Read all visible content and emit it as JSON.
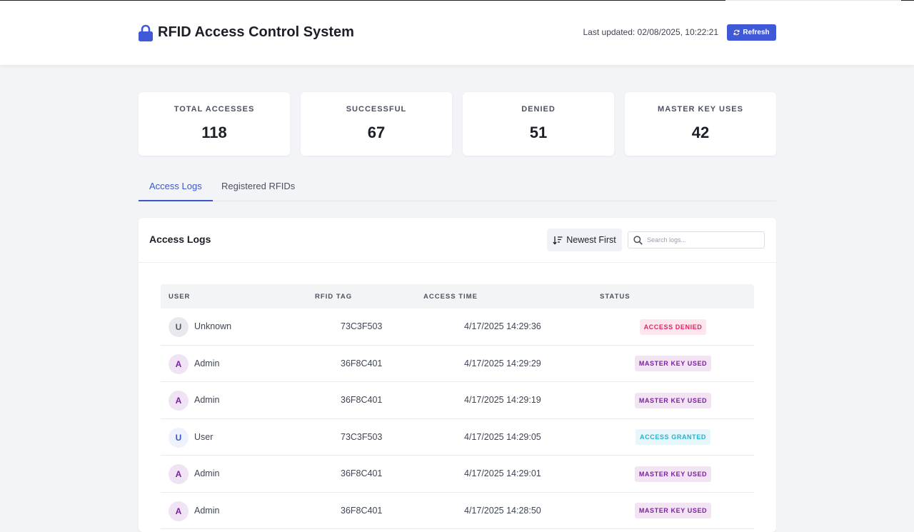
{
  "header": {
    "title": "RFID Access Control System",
    "last_updated": "Last updated: 02/08/2025, 10:22:21",
    "refresh_label": "Refresh",
    "lock_icon": "lock-icon",
    "accent": "#4059d9"
  },
  "stats": [
    {
      "label": "TOTAL ACCESSES",
      "value": "118"
    },
    {
      "label": "SUCCESSFUL",
      "value": "67"
    },
    {
      "label": "DENIED",
      "value": "51"
    },
    {
      "label": "MASTER KEY USES",
      "value": "42"
    }
  ],
  "tabs": [
    {
      "label": "Access Logs",
      "active": true
    },
    {
      "label": "Registered RFIDs",
      "active": false
    }
  ],
  "panel": {
    "title": "Access Logs",
    "sort_label": "Newest First",
    "search_placeholder": "Search logs..."
  },
  "table": {
    "columns": [
      "USER",
      "RFID TAG",
      "ACCESS TIME",
      "STATUS"
    ],
    "rows": [
      {
        "initial": "U",
        "user": "Unknown",
        "rfid": "73C3F503",
        "time": "4/17/2025 14:29:36",
        "status": "ACCESS DENIED",
        "kind": "unknown",
        "status_kind": "denied"
      },
      {
        "initial": "A",
        "user": "Admin",
        "rfid": "36F8C401",
        "time": "4/17/2025 14:29:29",
        "status": "MASTER KEY USED",
        "kind": "admin",
        "status_kind": "master"
      },
      {
        "initial": "A",
        "user": "Admin",
        "rfid": "36F8C401",
        "time": "4/17/2025 14:29:19",
        "status": "MASTER KEY USED",
        "kind": "admin",
        "status_kind": "master"
      },
      {
        "initial": "U",
        "user": "User",
        "rfid": "73C3F503",
        "time": "4/17/2025 14:29:05",
        "status": "ACCESS GRANTED",
        "kind": "user",
        "status_kind": "granted"
      },
      {
        "initial": "A",
        "user": "Admin",
        "rfid": "36F8C401",
        "time": "4/17/2025 14:29:01",
        "status": "MASTER KEY USED",
        "kind": "admin",
        "status_kind": "master"
      },
      {
        "initial": "A",
        "user": "Admin",
        "rfid": "36F8C401",
        "time": "4/17/2025 14:28:50",
        "status": "MASTER KEY USED",
        "kind": "admin",
        "status_kind": "master"
      }
    ]
  },
  "colors": {
    "denied": "#e0245e",
    "master": "#7b1fa2",
    "granted": "#1fb4d2"
  }
}
